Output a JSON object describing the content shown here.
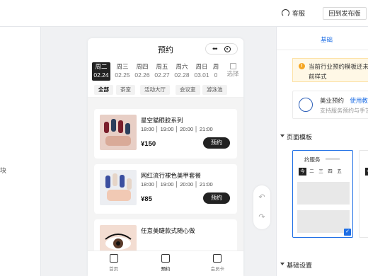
{
  "topbar": {
    "service_label": "客服",
    "back_label": "回到发布版"
  },
  "left_panel": {
    "module_label": "块"
  },
  "phone": {
    "title": "预约",
    "dates": [
      {
        "week": "周二",
        "day": "02.24",
        "active": true
      },
      {
        "week": "周三",
        "day": "02.25"
      },
      {
        "week": "周四",
        "day": "02.26"
      },
      {
        "week": "周五",
        "day": "02.27"
      },
      {
        "week": "周六",
        "day": "02.28"
      },
      {
        "week": "周日",
        "day": "03.01"
      },
      {
        "week": "周",
        "day": "0"
      }
    ],
    "select_label": "选择",
    "categories": [
      "全部",
      "茶室",
      "活动大厅",
      "会议室",
      "游泳池"
    ],
    "cards": [
      {
        "name": "星空猫眼胶系列",
        "times": "18:00 │ 19:00 │ 20:00 │ 21:00",
        "price": "¥150",
        "button": "预约"
      },
      {
        "name": "网红流行裸色美甲套餐",
        "times": "18:00 │ 19:00 │ 20:00 │ 21:00",
        "price": "¥85",
        "button": "预约"
      },
      {
        "name": "任意美睫款式随心做",
        "times": "",
        "price": "",
        "button": ""
      }
    ],
    "tabs": [
      {
        "label": "首页"
      },
      {
        "label": "预约"
      },
      {
        "label": "会员卡"
      }
    ]
  },
  "right_panel": {
    "tab_label": "基础",
    "notice_line1": "当前行业预约模板还未发",
    "notice_line2": "前样式",
    "industry_name": "美业预约",
    "industry_link": "使用教程",
    "industry_desc": "支持服务预约与手艺",
    "section_template": "页面模板",
    "template_label": "约服务",
    "template_days": [
      "今",
      "二",
      "三",
      "四",
      "五"
    ],
    "template2_day": "今",
    "section_basic": "基础设置"
  },
  "colors": {
    "accent": "#1f6fe5",
    "dark": "#222222",
    "warning": "#f5a623"
  }
}
